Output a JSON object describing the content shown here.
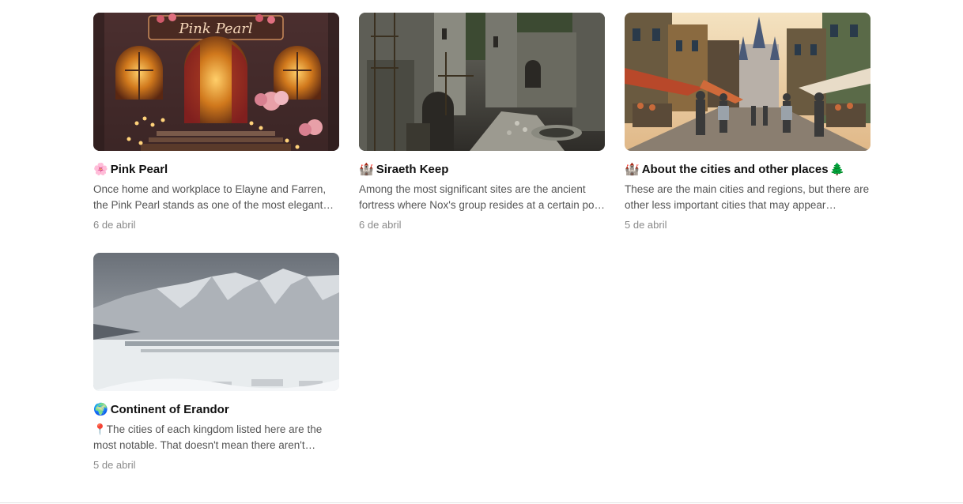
{
  "cards": [
    {
      "emoji": "🌸",
      "title": "Pink Pearl",
      "excerpt": "Once home and workplace to Elayne and Farren, the Pink Pearl stands as one of the most elegant establishments of the city...",
      "date": "6 de abril",
      "image_sign": "Pink Pearl"
    },
    {
      "emoji": "🏰",
      "title": "Siraeth Keep",
      "excerpt": "Among the most significant sites are the ancient fortress where Nox's group resides at a certain point in the story...",
      "date": "6 de abril"
    },
    {
      "emoji": "🏰",
      "title": "About the cities and other places",
      "emoji_end": "🌲",
      "excerpt": "These are the main cities and regions, but there are other less important cities that may appear throughout the story...",
      "date": "5 de abril"
    },
    {
      "emoji": "🌍",
      "title": "Continent of Erandor",
      "excerpt": "📍The cities of each kingdom listed here are the most notable. That doesn't mean there aren't others...",
      "date": "5 de abril"
    }
  ]
}
